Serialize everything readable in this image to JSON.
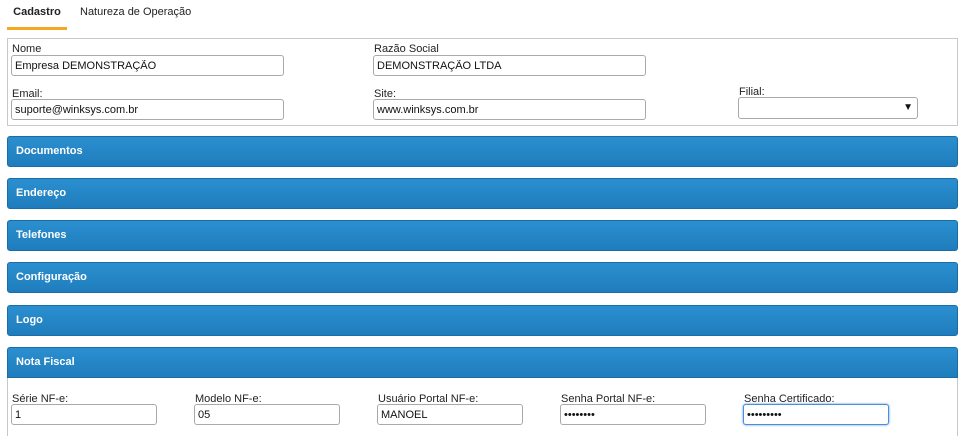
{
  "tabs": [
    {
      "label": "Cadastro",
      "active": true
    },
    {
      "label": "Natureza de Operação",
      "active": false
    }
  ],
  "cadastro": {
    "nome": {
      "label": "Nome",
      "value": "Empresa DEMONSTRAÇÃO"
    },
    "razao_social": {
      "label": "Razão Social",
      "value": "DEMONSTRAÇÃO LTDA"
    },
    "email": {
      "label": "Email:",
      "value": "suporte@winksys.com.br"
    },
    "site": {
      "label": "Site:",
      "value": "www.winksys.com.br"
    },
    "filial": {
      "label": "Filial:",
      "value": ""
    }
  },
  "panels": [
    {
      "label": "Documentos"
    },
    {
      "label": "Endereço"
    },
    {
      "label": "Telefones"
    },
    {
      "label": "Configuração"
    },
    {
      "label": "Logo"
    },
    {
      "label": "Nota Fiscal"
    }
  ],
  "nota_fiscal": {
    "serie": {
      "label": "Série NF-e:",
      "value": "1"
    },
    "modelo": {
      "label": "Modelo NF-e:",
      "value": "05"
    },
    "usuario_portal": {
      "label": "Usuário Portal NF-e:",
      "value": "MANOEL"
    },
    "senha_portal": {
      "label": "Senha Portal NF-e:",
      "value": "••••••••"
    },
    "senha_certificado": {
      "label": "Senha Certificado:",
      "value": "•••••••••"
    }
  },
  "colors": {
    "panel": "#1f7dbd",
    "tab_accent": "#f5a623",
    "focus": "#4a90d9"
  }
}
